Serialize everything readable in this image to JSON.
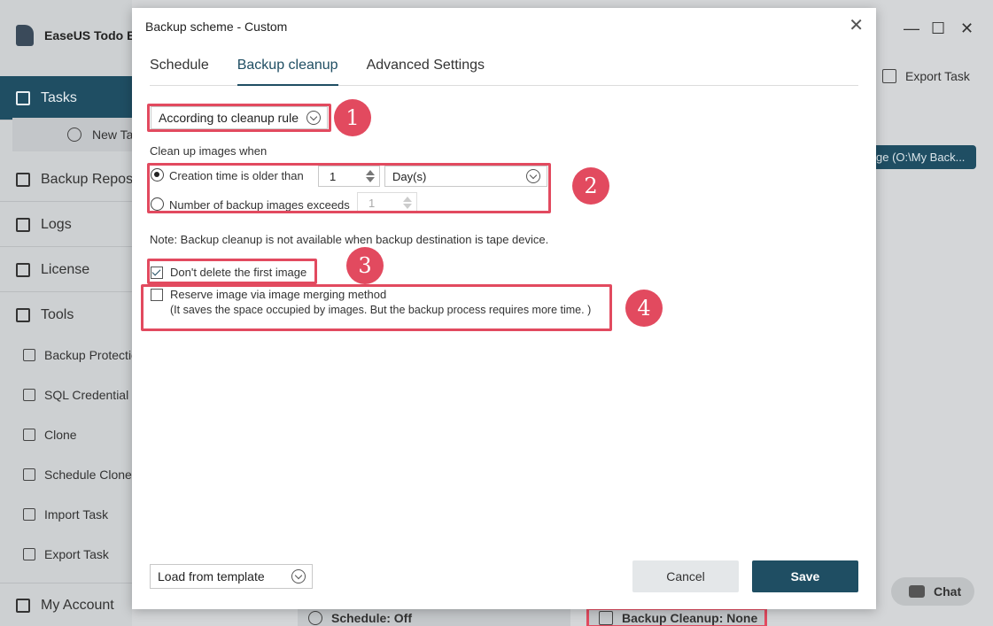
{
  "background_app": {
    "app_title": "EaseUS Todo Ba",
    "nav": {
      "tasks": "Tasks",
      "new_task": "New Ta",
      "backup_repository": "Backup Reposit",
      "logs": "Logs",
      "license": "License",
      "tools": "Tools",
      "my_account": "My Account"
    },
    "tools": [
      "Backup Protectio",
      "SQL Credential I",
      "Clone",
      "Schedule Clone",
      "Import Task",
      "Export Task"
    ],
    "export_task": "Export Task",
    "destination": "ge (O:\\My Back...",
    "chat": "Chat",
    "schedule_status": "Schedule: Off",
    "cleanup_status": "Backup Cleanup: None"
  },
  "dialog": {
    "title": "Backup scheme - Custom",
    "tabs": [
      "Schedule",
      "Backup cleanup",
      "Advanced Settings"
    ],
    "active_tab": "Backup cleanup",
    "cleanup_mode": "According to cleanup rule",
    "clean_up_heading": "Clean up images when",
    "creation_time_label": "Creation time is older than",
    "creation_time_value": "1",
    "creation_unit": "Day(s)",
    "number_images_label": "Number of backup images exceeds",
    "number_images_value": "1",
    "note": "Note: Backup cleanup is not available when backup destination is tape device.",
    "dont_delete_first": "Don't delete the first image",
    "reserve_merge": "Reserve image via image merging method",
    "reserve_merge_hint": "(It saves the space occupied by images. But the backup process requires more time. )",
    "load_template": "Load from template",
    "cancel": "Cancel",
    "save": "Save"
  },
  "annotations": [
    "1",
    "2",
    "3",
    "4"
  ],
  "colors": {
    "primary": "#1f4e63",
    "highlight": "#e24a5f"
  }
}
